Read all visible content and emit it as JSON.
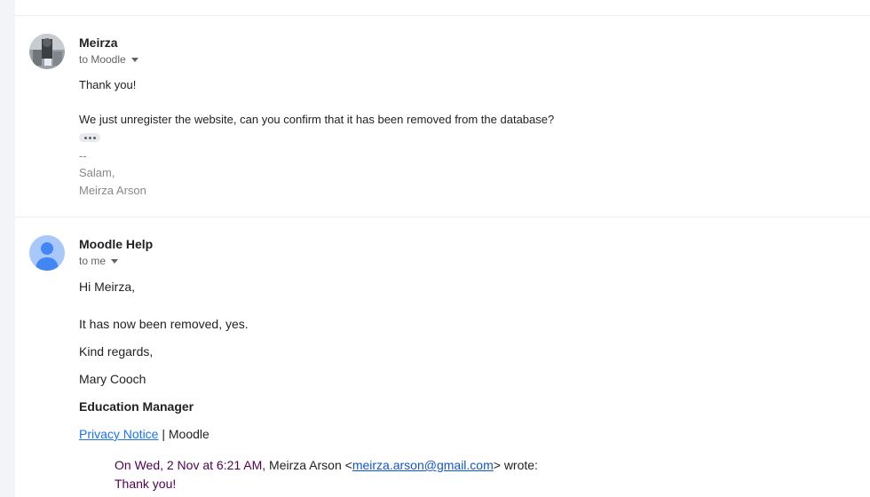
{
  "messages": [
    {
      "sender": "Meirza",
      "recipient_label": "to Moodle",
      "body": [
        "Thank you!",
        "We just unregister the website, can you confirm that it has been removed from the database?"
      ],
      "signature": [
        "--",
        "Salam,",
        "Meirza Arson"
      ]
    },
    {
      "sender": "Moodle Help",
      "recipient_label": "to me",
      "greeting": "Hi Meirza,",
      "paragraph": "It has now been removed, yes.",
      "closing": "Kind regards,",
      "name": "Mary Cooch",
      "title": "Education Manager",
      "privacy_link": "Privacy Notice",
      "privacy_suffix": "| Moodle",
      "quote": {
        "date": "On Wed, 2 Nov at 6:21 AM",
        "author": ", Meirza Arson <",
        "email": "meirza.arson@gmail.com",
        "wrote": "> wrote:",
        "first_line": "Thank you!"
      }
    }
  ],
  "colors": {
    "link": "#1a73e8",
    "quote_date": "#500050",
    "avatar_default": "#a8c7fa"
  },
  "icons": {
    "expand": "ellipsis-icon",
    "recipient_caret": "caret-down-icon",
    "default_avatar": "person-icon"
  }
}
